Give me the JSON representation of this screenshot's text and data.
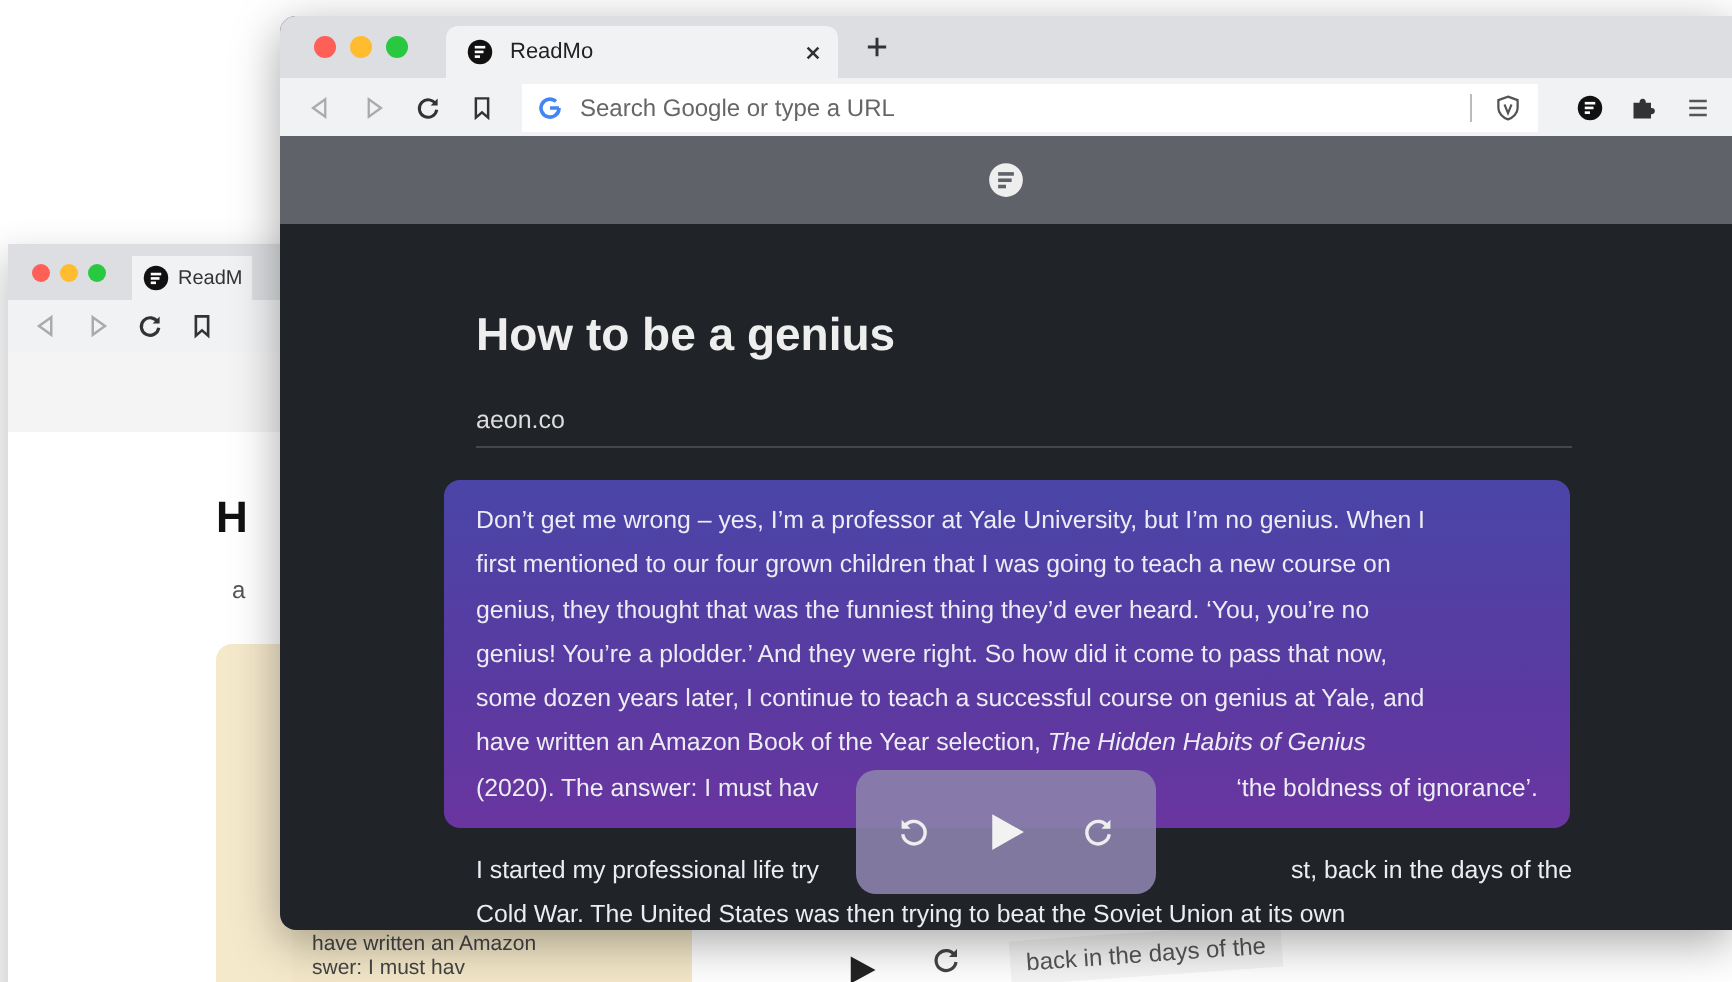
{
  "back_window": {
    "tab_title": "ReadM",
    "heading": "H",
    "source": "a",
    "excerpt_lines": [
      "have written an Amazon",
      "swer: I must hav"
    ],
    "right_excerpt": "back in the days of the"
  },
  "window": {
    "tab_title": "ReadMo",
    "address_placeholder": "Search Google or type a URL"
  },
  "article": {
    "title": "How to be a genius",
    "source": "aeon.co",
    "highlighted_lines": [
      {
        "left": "Don’t get me wrong – yes, I’m a professor at Yale University, but I’m no genius. When I"
      },
      {
        "left": "first mentioned to our four grown children that I was going to teach a new course on"
      },
      {
        "left": "genius, they thought that was the funniest thing they’d ever heard. ‘You, you’re no"
      },
      {
        "left": "genius! You’re a plodder.’ And they were right. So how did it come to pass that now,"
      },
      {
        "left": "some dozen years later, I continue to teach a successful course on genius at Yale, and"
      },
      {
        "left": "have written an Amazon Book of the Year selection, *The Hidden Habits of Genius*"
      },
      {
        "left": "(2020). The answer: I must hav",
        "right": "‘the boldness of ignorance’."
      }
    ],
    "lines": [
      {
        "left": "I started my professional life try",
        "right": "st, back in the days of the"
      },
      {
        "left": "Cold War. The United States was then trying to beat the Soviet Union at its own"
      }
    ]
  }
}
